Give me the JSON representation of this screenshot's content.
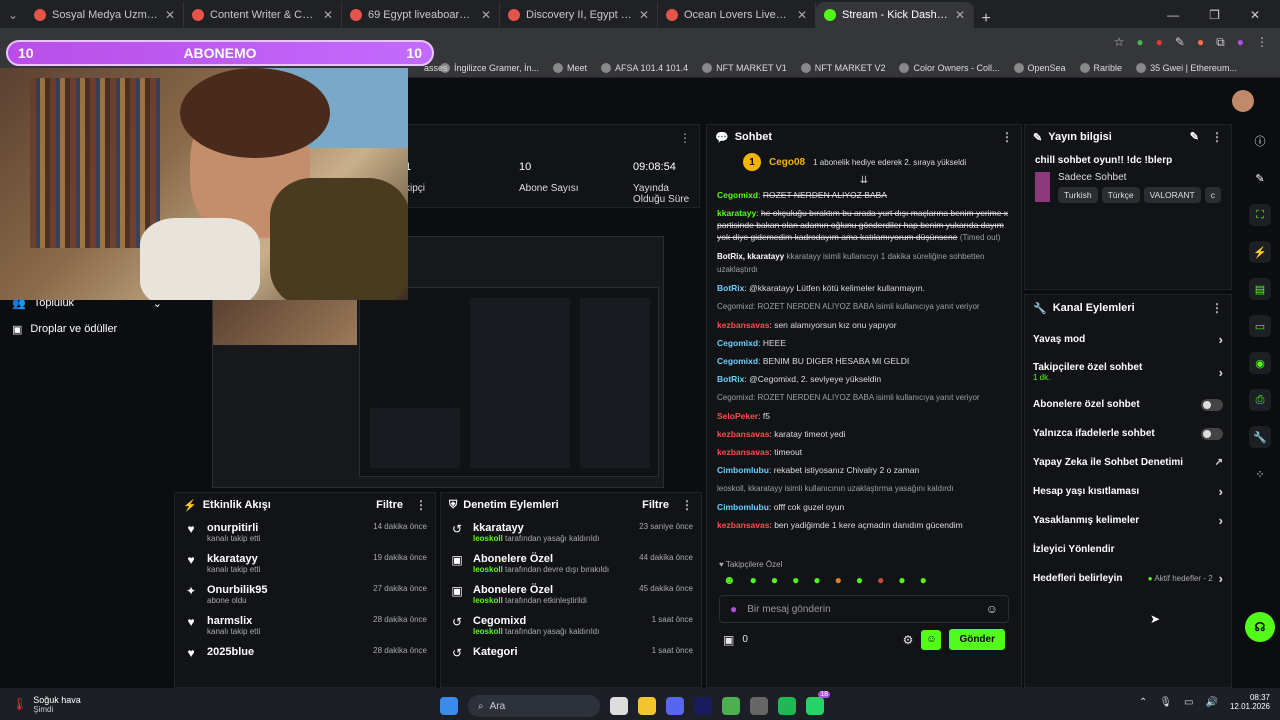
{
  "browser": {
    "tabs": [
      {
        "label": "Sosyal Medya Uzmanı Aranıyor",
        "active": false
      },
      {
        "label": "Content Writer & Community",
        "active": false
      },
      {
        "label": "69 Egypt liveaboards, May 2026",
        "active": false
      },
      {
        "label": "Discovery II, Egypt - LiveAboard",
        "active": false
      },
      {
        "label": "Ocean Lovers Liveaboard, Egypt",
        "active": false
      },
      {
        "label": "Stream - Kick Dashboard",
        "active": true
      }
    ],
    "bookmarks": [
      "İngilizce Gramer, İn...",
      "Meet",
      "AFSA 101.4 101.4",
      "NFT MARKET V1",
      "NFT MARKET V2",
      "Color Owners - Coll...",
      "OpenSea",
      "Rarible",
      "35 Gwei | Ethereum..."
    ],
    "bookmark_partial": "asses"
  },
  "overlay": {
    "left_num": "10",
    "title": "ABONEMO",
    "right_num": "10"
  },
  "stats": [
    {
      "value": "1",
      "label": "kipçi"
    },
    {
      "value": "10",
      "label": "Abone Sayısı"
    },
    {
      "value": "09:08:54",
      "label": "Yayında Olduğu Süre"
    }
  ],
  "left_nav": [
    {
      "label": "Topluluk"
    },
    {
      "label": "Droplar ve ödüller"
    }
  ],
  "activity": {
    "title": "Etkinlik Akışı",
    "filter": "Filtre",
    "items": [
      {
        "icon": "heart",
        "name": "onurpitirli",
        "sub": "kanalı takip etti",
        "time": "14 dakika önce"
      },
      {
        "icon": "heart",
        "name": "kkaratayy",
        "sub": "kanalı takip etti",
        "time": "19 dakika önce"
      },
      {
        "icon": "star",
        "name": "Onurbilik95",
        "sub": "abone oldu",
        "time": "27 dakika önce"
      },
      {
        "icon": "heart",
        "name": "harmslix",
        "sub": "kanalı takip etti",
        "time": "28 dakika önce"
      },
      {
        "icon": "heart",
        "name": "2025blue",
        "sub": "",
        "time": "28 dakika önce"
      }
    ]
  },
  "moderation": {
    "title": "Denetim Eylemleri",
    "filter": "Filtre",
    "items": [
      {
        "icon": "undo",
        "name": "kkaratayy",
        "actor": "leoskoll",
        "sub": "tarafından yasağı kaldırıldı",
        "time": "23 saniye önce"
      },
      {
        "icon": "gift",
        "name": "Abonelere Özel",
        "actor": "leoskoll",
        "sub": "tarafından devre dışı bırakıldı",
        "time": "44 dakika önce"
      },
      {
        "icon": "gift",
        "name": "Abonelere Özel",
        "actor": "leoskoll",
        "sub": "tarafından etkinleştirildi",
        "time": "45 dakika önce"
      },
      {
        "icon": "undo",
        "name": "Cegomixd",
        "actor": "leoskoll",
        "sub": "tarafından yasağı kaldırıldı",
        "time": "1 saat önce"
      },
      {
        "icon": "undo",
        "name": "Kategori",
        "actor": "",
        "sub": "",
        "time": "1 saat önce"
      }
    ]
  },
  "chat": {
    "title": "Sohbet",
    "pinned_user": "Cego08",
    "pinned_count": "1",
    "pinned_text": "1 abonelik hediye ederek 2. sıraya yükseldi",
    "messages": [
      {
        "user": "Cegomixd",
        "cls": "u-green",
        "text": "ROZET NERDEN ALIYOZ BABA",
        "strike": true
      },
      {
        "user": "kkaratayy",
        "cls": "u-green",
        "text": "he okçuluğu bıraktım bu arada yurt dışı maçlarına benim yerime x partisinde bakan olan adamın oğlunu gönderdiler hap benim yukarıda dayım yok diye gidemedim kadrodayım ama katılamıyorum düşünsene",
        "strike": true,
        "suffix": "(Timed out)"
      },
      {
        "sys": "kkaratayy isimli kullanıcıyı 1 dakika süreliğine sohbetten uzaklaştırdı",
        "actor": "BotRix, kkaratayy"
      },
      {
        "user": "BotRix",
        "cls": "u-cyan",
        "text": "@kkaratayy Lütfen kötü kelimeler kullanmayın."
      },
      {
        "sys": "Cegomixd: ROZET NERDEN ALIYOZ BABA isimli kullanıcıya yanıt veriyor"
      },
      {
        "user": "kezbansavas",
        "cls": "u-red",
        "text": "sen alamıyorsun kız onu yapıyor"
      },
      {
        "user": "Cegomixd",
        "cls": "u-cyan",
        "text": "HEEE"
      },
      {
        "user": "Cegomixd",
        "cls": "u-cyan",
        "text": "BENIM BU DIGER HESABA MI GELDI"
      },
      {
        "user": "BotRix",
        "cls": "u-cyan",
        "text": "@Cegomixd, 2. seviyeye yükseldin"
      },
      {
        "sys": "Cegomixd: ROZET NERDEN ALIYOZ BABA isimli kullanıcıya yanıt veriyor"
      },
      {
        "user": "SeloPeker",
        "cls": "u-red",
        "text": "f5"
      },
      {
        "user": "kezbansavas",
        "cls": "u-red",
        "text": "karatay timeot yedi"
      },
      {
        "user": "kezbansavas",
        "cls": "u-red",
        "text": "timeout"
      },
      {
        "user": "Cimbomlubu",
        "cls": "u-cyan",
        "text": "rekabet istiyosanız Chivalry 2 o zaman"
      },
      {
        "sys": "leoskoll, kkaratayy isimli kullanıcının uzaklaştırma yasağını kaldırdı"
      },
      {
        "user": "Cimbomlubu",
        "cls": "u-cyan",
        "text": "offf cok guzel oyun"
      },
      {
        "user": "kezbansavas",
        "cls": "u-red",
        "text": "ben yadiğimde 1 kere açmadın danıdım gücendim"
      }
    ],
    "followers_only_label": "Takipçilere Özel",
    "input_placeholder": "Bir mesaj gönderin",
    "count": "0",
    "send": "Gönder"
  },
  "stream_info": {
    "title": "Yayın bilgisi",
    "stream_title": "chill sohbet oyun!! !dc !blerp",
    "category": "Sadece Sohbet",
    "tags": [
      "Turkish",
      "Türkçe",
      "VALORANT",
      "c"
    ]
  },
  "channel_actions": {
    "title": "Kanal Eylemleri",
    "items": [
      {
        "label": "Yavaş mod",
        "control": "chevron"
      },
      {
        "label": "Takipçilere özel sohbet",
        "sub": "1 dk.",
        "control": "chevron"
      },
      {
        "label": "Abonelere özel sohbet",
        "control": "toggle"
      },
      {
        "label": "Yalnızca ifadelerle sohbet",
        "control": "toggle"
      },
      {
        "label": "Yapay Zeka ile Sohbet Denetimi",
        "control": "external"
      },
      {
        "label": "Hesap yaşı kısıtlaması",
        "control": "chevron"
      },
      {
        "label": "Yasaklanmış kelimeler",
        "control": "chevron"
      },
      {
        "label": "İzleyici Yönlendir",
        "control": "none"
      },
      {
        "label": "Hedefleri belirleyin",
        "control": "chevron",
        "badge": "Aktif hedefler - 2"
      }
    ]
  },
  "taskbar": {
    "weather": "Soğuk hava",
    "weather_sub": "Şimdi",
    "search": "Ara",
    "time": "08:37",
    "date": "12.01.2026",
    "badge": "18"
  }
}
